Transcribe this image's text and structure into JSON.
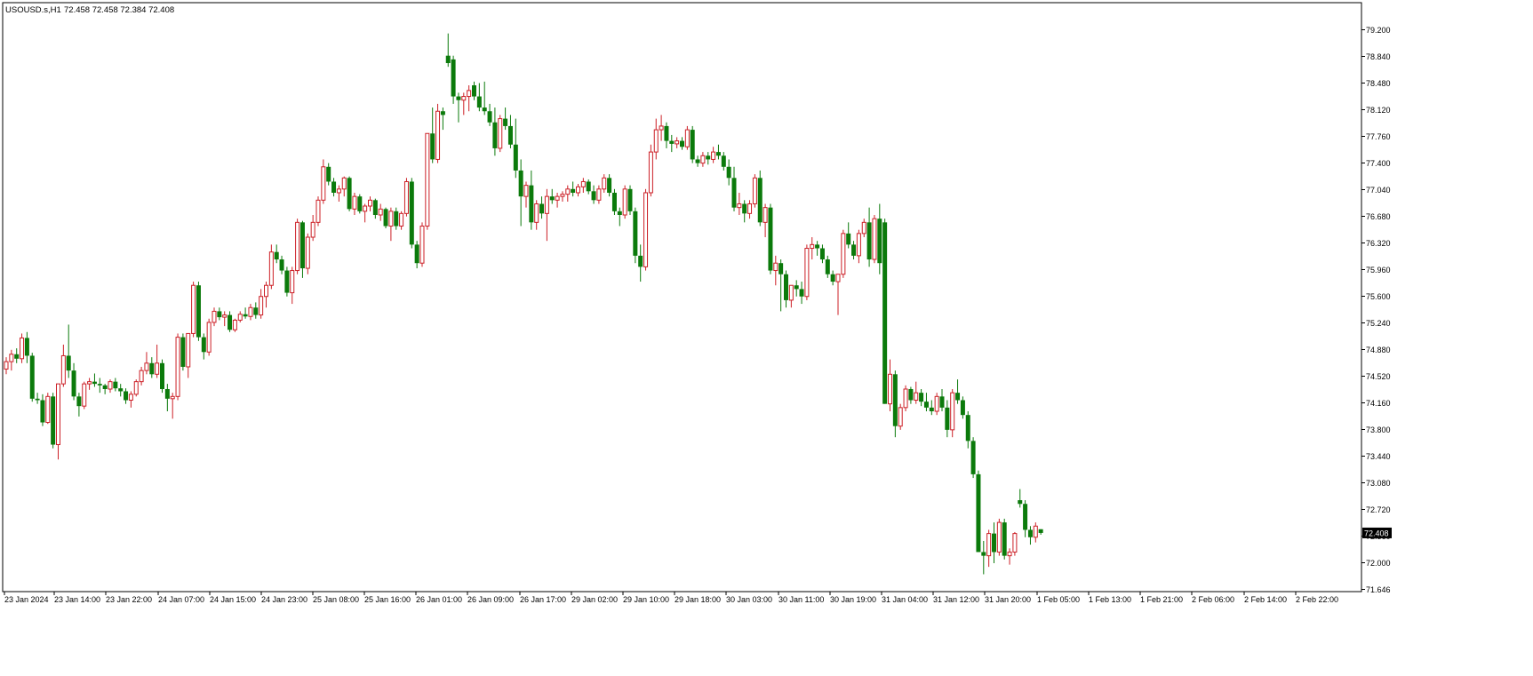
{
  "header": {
    "symbol_timeframe": "USOUSD.s,H1",
    "ohlc": "72.458 72.458 72.384 72.408"
  },
  "colors": {
    "background": "#ffffff",
    "axis_line": "#000000",
    "up_candle": "#cc1f26",
    "down_candle": "#0b7a0b",
    "current_price_box": "#000000",
    "current_price_text": "#ffffff"
  },
  "chart_data": {
    "type": "candlestick",
    "ylim": [
      71.646,
      79.3
    ],
    "y_ticks": [
      "79.200",
      "78.840",
      "78.480",
      "78.120",
      "77.760",
      "77.400",
      "77.040",
      "76.680",
      "76.320",
      "75.960",
      "75.600",
      "75.240",
      "74.880",
      "74.520",
      "74.160",
      "73.800",
      "73.440",
      "73.080",
      "72.720",
      "72.360",
      "72.000",
      "71.646"
    ],
    "x_tick_labels": [
      "23 Jan 2024",
      "23 Jan 14:00",
      "23 Jan 22:00",
      "24 Jan 07:00",
      "24 Jan 15:00",
      "24 Jan 23:00",
      "25 Jan 08:00",
      "25 Jan 16:00",
      "26 Jan 01:00",
      "26 Jan 09:00",
      "26 Jan 17:00",
      "29 Jan 02:00",
      "29 Jan 10:00",
      "29 Jan 18:00",
      "30 Jan 03:00",
      "30 Jan 11:00",
      "30 Jan 19:00",
      "31 Jan 04:00",
      "31 Jan 12:00",
      "31 Jan 20:00",
      "1 Feb 05:00",
      "1 Feb 13:00",
      "1 Feb 21:00",
      "2 Feb 06:00",
      "2 Feb 14:00",
      "2 Feb 22:00"
    ],
    "current_price": "72.408",
    "grid": false,
    "candles": [
      [
        74.62,
        74.78,
        74.55,
        74.72
      ],
      [
        74.72,
        74.88,
        74.6,
        74.82
      ],
      [
        74.82,
        74.9,
        74.7,
        74.76
      ],
      [
        74.76,
        75.1,
        74.7,
        75.04
      ],
      [
        75.04,
        75.12,
        74.7,
        74.8
      ],
      [
        74.8,
        74.84,
        74.18,
        74.22
      ],
      [
        74.22,
        74.3,
        74.15,
        74.2
      ],
      [
        74.2,
        74.28,
        73.85,
        73.9
      ],
      [
        73.9,
        74.3,
        73.88,
        74.25
      ],
      [
        74.25,
        74.3,
        73.55,
        73.6
      ],
      [
        73.6,
        74.42,
        73.4,
        74.42
      ],
      [
        74.42,
        74.95,
        74.38,
        74.8
      ],
      [
        74.8,
        75.22,
        74.5,
        74.6
      ],
      [
        74.6,
        74.7,
        74.2,
        74.25
      ],
      [
        74.25,
        74.3,
        73.98,
        74.12
      ],
      [
        74.12,
        74.45,
        74.08,
        74.42
      ],
      [
        74.42,
        74.5,
        74.34,
        74.45
      ],
      [
        74.45,
        74.56,
        74.38,
        74.42
      ],
      [
        74.42,
        74.5,
        74.3,
        74.4
      ],
      [
        74.4,
        74.42,
        74.28,
        74.35
      ],
      [
        74.35,
        74.48,
        74.3,
        74.45
      ],
      [
        74.45,
        74.5,
        74.32,
        74.36
      ],
      [
        74.36,
        74.42,
        74.25,
        74.32
      ],
      [
        74.32,
        74.36,
        74.15,
        74.2
      ],
      [
        74.2,
        74.32,
        74.1,
        74.28
      ],
      [
        74.28,
        74.48,
        74.25,
        74.45
      ],
      [
        74.45,
        74.65,
        74.4,
        74.6
      ],
      [
        74.6,
        74.85,
        74.55,
        74.7
      ],
      [
        74.7,
        74.78,
        74.5,
        74.55
      ],
      [
        74.55,
        74.95,
        74.5,
        74.7
      ],
      [
        74.7,
        74.75,
        74.3,
        74.35
      ],
      [
        74.35,
        74.42,
        74.05,
        74.22
      ],
      [
        74.22,
        74.3,
        73.95,
        74.25
      ],
      [
        74.25,
        75.1,
        74.2,
        75.05
      ],
      [
        75.05,
        75.1,
        74.6,
        74.65
      ],
      [
        74.65,
        75.1,
        74.5,
        75.1
      ],
      [
        75.1,
        75.8,
        75.05,
        75.75
      ],
      [
        75.75,
        75.8,
        75.0,
        75.05
      ],
      [
        75.05,
        75.1,
        74.75,
        74.85
      ],
      [
        74.85,
        75.3,
        74.8,
        75.25
      ],
      [
        75.25,
        75.45,
        75.2,
        75.4
      ],
      [
        75.4,
        75.45,
        75.28,
        75.32
      ],
      [
        75.32,
        75.4,
        75.2,
        75.35
      ],
      [
        75.35,
        75.4,
        75.12,
        75.15
      ],
      [
        75.15,
        75.3,
        75.12,
        75.28
      ],
      [
        75.28,
        75.4,
        75.25,
        75.36
      ],
      [
        75.36,
        75.45,
        75.3,
        75.33
      ],
      [
        75.33,
        75.5,
        75.28,
        75.45
      ],
      [
        75.45,
        75.52,
        75.3,
        75.35
      ],
      [
        75.35,
        75.7,
        75.3,
        75.6
      ],
      [
        75.6,
        75.8,
        75.45,
        75.75
      ],
      [
        75.75,
        76.3,
        75.7,
        76.2
      ],
      [
        76.2,
        76.3,
        76.05,
        76.1
      ],
      [
        76.1,
        76.15,
        75.9,
        75.95
      ],
      [
        75.95,
        76.0,
        75.6,
        75.65
      ],
      [
        75.65,
        76.0,
        75.5,
        75.95
      ],
      [
        75.95,
        76.65,
        75.9,
        76.6
      ],
      [
        76.6,
        76.62,
        75.85,
        75.98
      ],
      [
        75.98,
        76.45,
        75.9,
        76.4
      ],
      [
        76.4,
        76.7,
        76.35,
        76.6
      ],
      [
        76.6,
        76.95,
        76.55,
        76.9
      ],
      [
        76.9,
        77.45,
        76.85,
        77.35
      ],
      [
        77.35,
        77.4,
        77.1,
        77.15
      ],
      [
        77.15,
        77.2,
        76.95,
        77.0
      ],
      [
        77.0,
        77.1,
        76.88,
        77.05
      ],
      [
        77.05,
        77.22,
        76.95,
        77.2
      ],
      [
        77.2,
        77.22,
        76.75,
        76.78
      ],
      [
        76.78,
        77.0,
        76.7,
        76.95
      ],
      [
        76.95,
        76.98,
        76.72,
        76.75
      ],
      [
        76.75,
        76.85,
        76.6,
        76.82
      ],
      [
        76.82,
        76.95,
        76.75,
        76.9
      ],
      [
        76.9,
        76.92,
        76.65,
        76.7
      ],
      [
        76.7,
        76.85,
        76.62,
        76.78
      ],
      [
        76.78,
        76.8,
        76.52,
        76.55
      ],
      [
        76.55,
        76.8,
        76.35,
        76.75
      ],
      [
        76.75,
        76.8,
        76.5,
        76.55
      ],
      [
        76.55,
        76.75,
        76.5,
        76.72
      ],
      [
        76.72,
        77.2,
        76.68,
        77.15
      ],
      [
        77.15,
        77.2,
        76.25,
        76.3
      ],
      [
        76.3,
        76.35,
        75.98,
        76.05
      ],
      [
        76.05,
        76.6,
        76.0,
        76.55
      ],
      [
        76.55,
        77.8,
        76.5,
        77.8
      ],
      [
        77.8,
        78.15,
        77.4,
        77.45
      ],
      [
        77.45,
        78.2,
        77.4,
        78.1
      ],
      [
        78.1,
        78.15,
        77.85,
        78.05
      ],
      [
        78.85,
        79.15,
        78.7,
        78.75
      ],
      [
        78.8,
        78.85,
        78.2,
        78.3
      ],
      [
        78.3,
        78.35,
        77.95,
        78.25
      ],
      [
        78.25,
        78.35,
        78.05,
        78.3
      ],
      [
        78.3,
        78.45,
        78.1,
        78.38
      ],
      [
        78.45,
        78.5,
        78.25,
        78.3
      ],
      [
        78.3,
        78.48,
        78.1,
        78.15
      ],
      [
        78.15,
        78.5,
        78.05,
        78.1
      ],
      [
        78.1,
        78.2,
        77.9,
        77.95
      ],
      [
        77.95,
        78.15,
        77.5,
        77.6
      ],
      [
        77.6,
        78.05,
        77.55,
        78.0
      ],
      [
        78.0,
        78.15,
        77.85,
        77.9
      ],
      [
        77.9,
        78.05,
        77.6,
        77.65
      ],
      [
        77.65,
        78.0,
        77.2,
        77.3
      ],
      [
        77.3,
        77.45,
        76.55,
        76.95
      ],
      [
        76.95,
        77.15,
        76.8,
        77.1
      ],
      [
        77.1,
        77.3,
        76.5,
        76.6
      ],
      [
        76.6,
        76.9,
        76.5,
        76.85
      ],
      [
        76.85,
        76.95,
        76.65,
        76.72
      ],
      [
        76.72,
        77.05,
        76.35,
        76.95
      ],
      [
        76.95,
        77.05,
        76.85,
        76.9
      ],
      [
        76.9,
        77.0,
        76.8,
        76.95
      ],
      [
        76.95,
        77.02,
        76.88,
        76.98
      ],
      [
        76.98,
        77.1,
        76.88,
        77.05
      ],
      [
        77.05,
        77.15,
        76.95,
        77.0
      ],
      [
        77.0,
        77.12,
        76.95,
        77.08
      ],
      [
        77.08,
        77.2,
        77.0,
        77.15
      ],
      [
        77.15,
        77.18,
        76.98,
        77.02
      ],
      [
        77.02,
        77.1,
        76.85,
        76.9
      ],
      [
        76.9,
        77.1,
        76.85,
        77.05
      ],
      [
        77.05,
        77.25,
        77.0,
        77.2
      ],
      [
        77.2,
        77.25,
        76.95,
        77.0
      ],
      [
        77.0,
        77.05,
        76.7,
        76.75
      ],
      [
        76.75,
        76.8,
        76.55,
        76.7
      ],
      [
        76.7,
        77.1,
        76.65,
        77.05
      ],
      [
        77.05,
        77.1,
        76.7,
        76.75
      ],
      [
        76.75,
        76.8,
        76.05,
        76.15
      ],
      [
        76.15,
        76.3,
        75.8,
        76.0
      ],
      [
        76.0,
        77.05,
        75.95,
        77.0
      ],
      [
        77.0,
        77.65,
        76.95,
        77.55
      ],
      [
        77.55,
        78.0,
        77.45,
        77.85
      ],
      [
        77.85,
        78.05,
        77.7,
        77.9
      ],
      [
        77.9,
        77.95,
        77.6,
        77.7
      ],
      [
        77.7,
        77.78,
        77.55,
        77.66
      ],
      [
        77.66,
        77.75,
        77.6,
        77.7
      ],
      [
        77.7,
        77.75,
        77.58,
        77.62
      ],
      [
        77.62,
        77.9,
        77.58,
        77.85
      ],
      [
        77.85,
        77.9,
        77.4,
        77.45
      ],
      [
        77.45,
        77.5,
        77.35,
        77.4
      ],
      [
        77.4,
        77.55,
        77.35,
        77.5
      ],
      [
        77.5,
        77.55,
        77.38,
        77.45
      ],
      [
        77.45,
        77.62,
        77.4,
        77.55
      ],
      [
        77.55,
        77.65,
        77.45,
        77.5
      ],
      [
        77.5,
        77.55,
        77.3,
        77.35
      ],
      [
        77.35,
        77.45,
        77.1,
        77.2
      ],
      [
        77.2,
        77.35,
        76.75,
        76.8
      ],
      [
        76.8,
        77.0,
        76.7,
        76.85
      ],
      [
        76.85,
        76.9,
        76.6,
        76.72
      ],
      [
        76.72,
        76.9,
        76.65,
        76.85
      ],
      [
        76.85,
        77.25,
        76.8,
        77.2
      ],
      [
        77.2,
        77.3,
        76.55,
        76.6
      ],
      [
        76.6,
        76.85,
        76.4,
        76.8
      ],
      [
        76.8,
        76.85,
        75.9,
        75.95
      ],
      [
        75.95,
        76.15,
        75.75,
        76.05
      ],
      [
        76.05,
        76.1,
        75.4,
        75.9
      ],
      [
        75.9,
        75.95,
        75.45,
        75.55
      ],
      [
        75.55,
        75.7,
        75.45,
        75.75
      ],
      [
        75.75,
        75.82,
        75.6,
        75.7
      ],
      [
        75.7,
        75.8,
        75.5,
        75.6
      ],
      [
        75.6,
        76.3,
        75.55,
        76.25
      ],
      [
        76.25,
        76.4,
        76.1,
        76.3
      ],
      [
        76.3,
        76.35,
        76.15,
        76.25
      ],
      [
        76.25,
        76.3,
        76.05,
        76.1
      ],
      [
        76.1,
        76.15,
        75.85,
        75.9
      ],
      [
        75.9,
        75.95,
        75.75,
        75.8
      ],
      [
        75.8,
        75.85,
        75.35,
        75.9
      ],
      [
        75.9,
        76.5,
        75.85,
        76.45
      ],
      [
        76.45,
        76.6,
        76.25,
        76.3
      ],
      [
        76.3,
        76.35,
        76.1,
        76.15
      ],
      [
        76.15,
        76.5,
        76.05,
        76.45
      ],
      [
        76.45,
        76.65,
        76.4,
        76.6
      ],
      [
        76.6,
        76.8,
        76.0,
        76.1
      ],
      [
        76.1,
        76.7,
        76.05,
        76.65
      ],
      [
        76.65,
        76.85,
        75.9,
        76.05
      ],
      [
        76.6,
        76.65,
        74.15,
        74.15
      ],
      [
        74.15,
        74.75,
        74.05,
        74.55
      ],
      [
        74.55,
        74.6,
        73.7,
        73.85
      ],
      [
        73.85,
        74.15,
        73.8,
        74.1
      ],
      [
        74.1,
        74.4,
        74.05,
        74.35
      ],
      [
        74.35,
        74.38,
        74.15,
        74.2
      ],
      [
        74.2,
        74.45,
        74.15,
        74.3
      ],
      [
        74.3,
        74.35,
        74.12,
        74.18
      ],
      [
        74.18,
        74.3,
        74.05,
        74.1
      ],
      [
        74.1,
        74.2,
        74.0,
        74.05
      ],
      [
        74.05,
        74.3,
        74.0,
        74.25
      ],
      [
        74.25,
        74.35,
        74.05,
        74.1
      ],
      [
        74.1,
        74.2,
        73.7,
        73.8
      ],
      [
        73.8,
        74.35,
        73.7,
        74.3
      ],
      [
        74.3,
        74.48,
        74.15,
        74.2
      ],
      [
        74.2,
        74.25,
        73.95,
        74.0
      ],
      [
        74.0,
        74.05,
        73.55,
        73.65
      ],
      [
        73.65,
        73.7,
        73.15,
        73.2
      ],
      [
        73.2,
        73.25,
        72.15,
        72.15
      ],
      [
        72.15,
        72.3,
        71.85,
        72.1
      ],
      [
        72.1,
        72.45,
        71.95,
        72.4
      ],
      [
        72.4,
        72.55,
        72.0,
        72.15
      ],
      [
        72.15,
        72.6,
        72.1,
        72.55
      ],
      [
        72.55,
        72.6,
        72.05,
        72.1
      ],
      [
        72.1,
        72.2,
        71.98,
        72.15
      ],
      [
        72.15,
        72.42,
        72.1,
        72.4
      ],
      [
        72.85,
        73.0,
        72.75,
        72.8
      ],
      [
        72.8,
        72.85,
        72.35,
        72.45
      ],
      [
        72.45,
        72.5,
        72.25,
        72.35
      ],
      [
        72.35,
        72.55,
        72.28,
        72.5
      ],
      [
        72.458,
        72.458,
        72.384,
        72.408
      ]
    ]
  }
}
